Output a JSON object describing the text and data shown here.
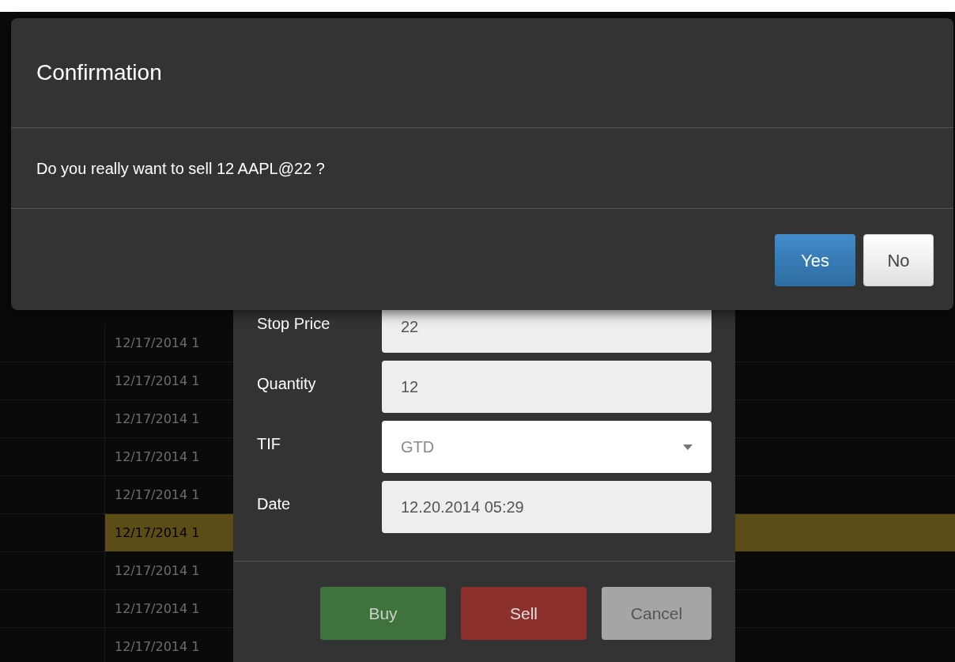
{
  "grid": {
    "rows": [
      {
        "time": "12/17/2014 1",
        "selected": false
      },
      {
        "time": "12/17/2014 1",
        "selected": false
      },
      {
        "time": "12/17/2014 1",
        "selected": false
      },
      {
        "time": "12/17/2014 1",
        "selected": false
      },
      {
        "time": "12/17/2014 1",
        "selected": false
      },
      {
        "time": "12/17/2014 1",
        "selected": true
      },
      {
        "time": "12/17/2014 1",
        "selected": false
      },
      {
        "time": "12/17/2014 1",
        "selected": false
      },
      {
        "time": "12/17/2014 1",
        "selected": false
      }
    ]
  },
  "order_dialog": {
    "fields": [
      {
        "label": "Stop Price",
        "value": "22",
        "kind": "text"
      },
      {
        "label": "Quantity",
        "value": "12",
        "kind": "text"
      },
      {
        "label": "TIF",
        "value": "GTD",
        "kind": "select"
      },
      {
        "label": "Date",
        "value": "12.20.2014 05:29",
        "kind": "text"
      }
    ],
    "buttons": [
      {
        "label": "Buy",
        "kind": "buy"
      },
      {
        "label": "Sell",
        "kind": "sell"
      },
      {
        "label": "Cancel",
        "kind": "cancel"
      }
    ]
  },
  "confirmation": {
    "title": "Confirmation",
    "message": "Do you really want to sell 12 AAPL@22 ?",
    "buttons": [
      {
        "label": "Yes",
        "kind": "primary"
      },
      {
        "label": "No",
        "kind": "default"
      }
    ]
  }
}
